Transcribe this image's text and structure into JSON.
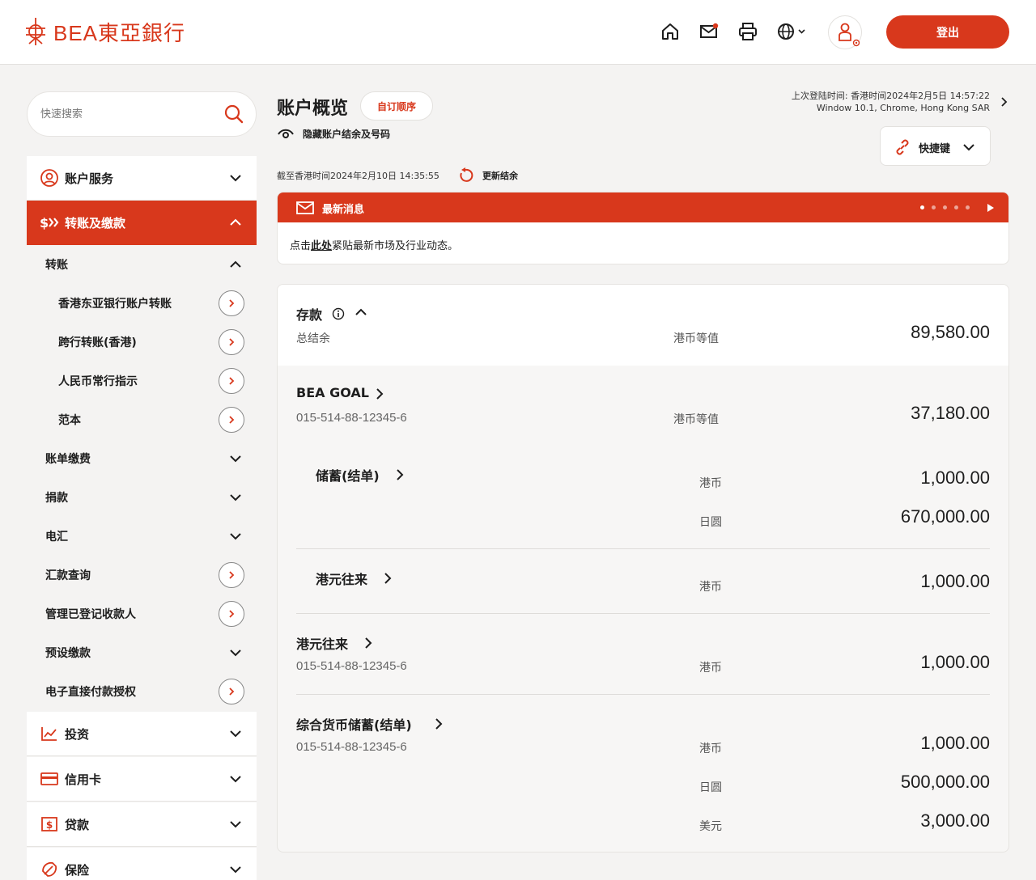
{
  "header": {
    "logo_text": "BEA東亞銀行",
    "logout_label": "登出",
    "icons": [
      "home-icon",
      "mail-icon",
      "print-icon",
      "globe-icon",
      "profile-icon"
    ]
  },
  "sidebar": {
    "search_placeholder": "快速搜索",
    "account_services": "账户服务",
    "transfers": "转账及缴款",
    "sub_transfer": "转账",
    "items": [
      {
        "label": "香港东亚银行账户转账"
      },
      {
        "label": "跨行转账(香港)"
      },
      {
        "label": "人民币常行指示"
      },
      {
        "label": "范本"
      }
    ],
    "bill_pay": "账单缴费",
    "donation": "捐款",
    "wire": "电汇",
    "remit_query": "汇款查询",
    "manage_payees": "管理已登记收款人",
    "preset_pay": "预设缴款",
    "edda": "电子直接付款授权",
    "investment": "投资",
    "credit_card": "信用卡",
    "loans": "贷款",
    "insurance": "保险"
  },
  "main": {
    "title": "账户概览",
    "custom_order": "自订顺序",
    "hide_label": "隐藏账户结余及号码",
    "last_login_line1": "上次登陆时间: 香港时间2024年2月5日 14:57:22",
    "last_login_line2": "Window 10.1, Chrome, Hong Kong SAR",
    "shortcut": "快捷键",
    "as_of": "截至香港时间2024年2月10日 14:35:55",
    "refresh": "更新结余",
    "news_title": "最新消息",
    "news_prefix": "点击",
    "news_link": "此处",
    "news_suffix": "紧贴最新市场及行业动态。"
  },
  "deposits": {
    "title": "存款",
    "total_label": "总结余",
    "total_ccy": "港币等值",
    "total_amount": "89,580.00",
    "accounts": [
      {
        "name": "BEA GOAL",
        "number": "015-514-88-12345-6",
        "ccy": "港币等值",
        "amount": "37,180.00",
        "sub": [
          {
            "name": "储蓄(结单)",
            "lines": [
              {
                "ccy": "港币",
                "amount": "1,000.00"
              },
              {
                "ccy": "日圆",
                "amount": "670,000.00"
              }
            ]
          },
          {
            "name": "港元往来",
            "lines": [
              {
                "ccy": "港币",
                "amount": "1,000.00"
              }
            ]
          }
        ]
      },
      {
        "name": "港元往来",
        "number": "015-514-88-12345-6",
        "ccy": "港币",
        "amount": "1,000.00"
      },
      {
        "name": "综合货币储蓄(结单)",
        "number": "015-514-88-12345-6",
        "lines": [
          {
            "ccy": "港币",
            "amount": "1,000.00"
          },
          {
            "ccy": "日圆",
            "amount": "500,000.00"
          },
          {
            "ccy": "美元",
            "amount": "3,000.00"
          }
        ]
      }
    ]
  },
  "colors": {
    "brand": "#d8381c",
    "background": "#f4f3f2"
  }
}
